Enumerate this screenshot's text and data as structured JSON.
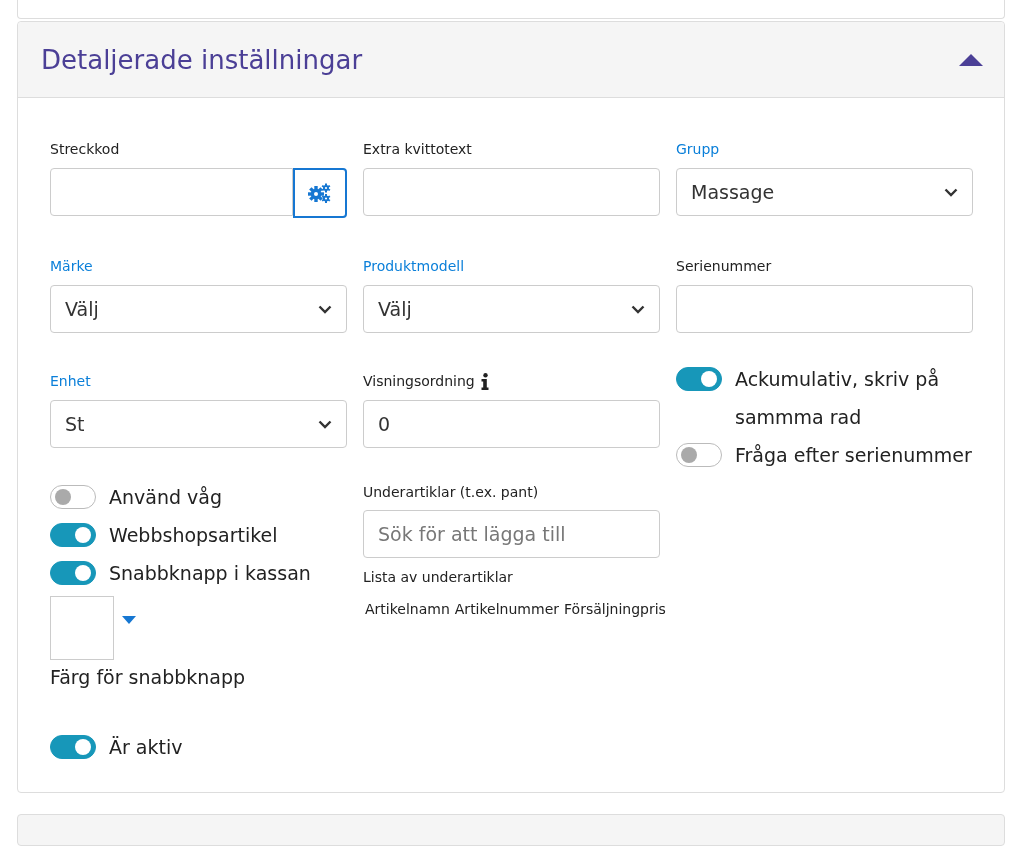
{
  "panel": {
    "title": "Detaljerade inställningar",
    "expanded": true
  },
  "fields": [
    {
      "kind": "input-button",
      "label": "Streckkod",
      "linked": false
    },
    {
      "kind": "input",
      "label": "Extra kvittotext",
      "linked": false
    },
    {
      "kind": "select",
      "label": "Grupp",
      "linked": true,
      "value": "Massage"
    },
    {
      "kind": "select",
      "label": "Märke",
      "linked": true,
      "value": "Välj"
    },
    {
      "kind": "select",
      "label": "Produktmodell",
      "linked": true,
      "value": "Välj"
    },
    {
      "kind": "input",
      "label": "Serienummer",
      "linked": false
    },
    {
      "kind": "select",
      "label": "Enhet",
      "linked": true,
      "value": "St"
    },
    {
      "kind": "input",
      "label": "Visningsordning",
      "linked": false,
      "info": true,
      "value": "0"
    }
  ],
  "side_toggles": [
    {
      "label": "Ackumulativ, skriv på sammma rad",
      "on": true
    },
    {
      "label": "Fråga efter serienummer",
      "on": false
    }
  ],
  "toggles": [
    {
      "label": "Använd våg",
      "on": false
    },
    {
      "label": "Webbshopsartikel",
      "on": true
    },
    {
      "label": "Snabbknapp i kassan",
      "on": true
    }
  ],
  "quick_button_color": {
    "label": "Färg för snabbknapp"
  },
  "active_toggle": {
    "label": "Är aktiv",
    "on": true
  },
  "sub_articles": {
    "label": "Underartiklar (t.ex. pant)",
    "placeholder": "Sök för att lägga till",
    "list_title": "Lista av underartiklar",
    "columns": [
      "Artikelnamn",
      "Artikelnummer",
      "Försäljningpris"
    ]
  }
}
